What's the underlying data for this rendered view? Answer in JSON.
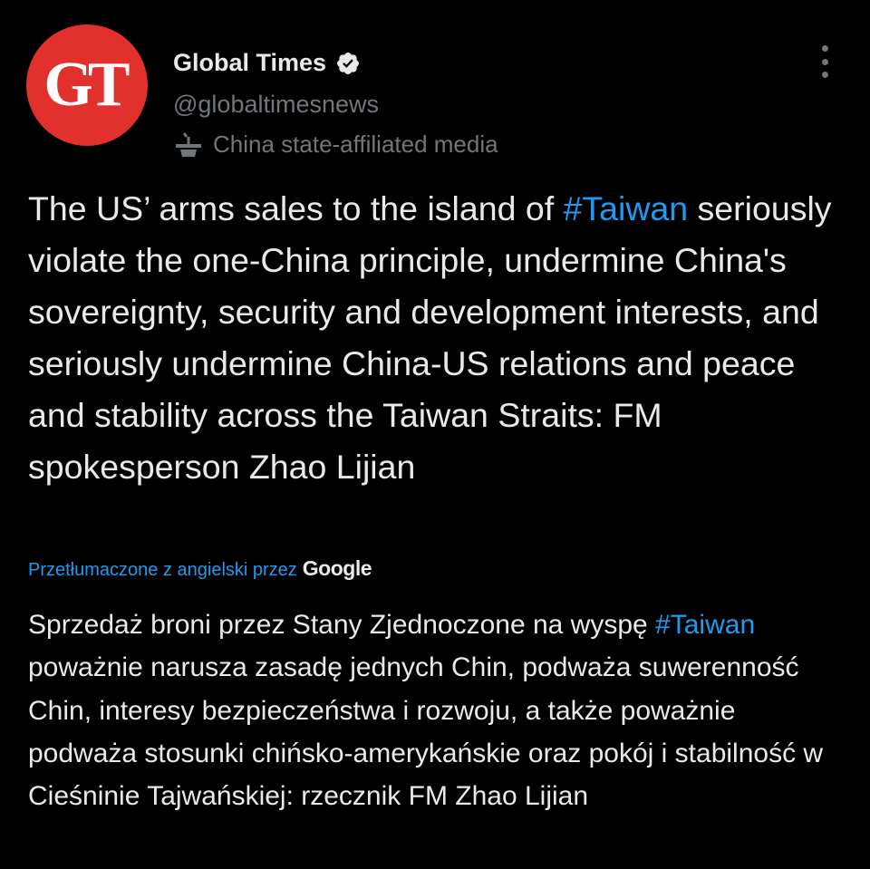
{
  "avatar": {
    "text": "GT",
    "color": "#e2302c"
  },
  "author": {
    "name": "Global Times",
    "handle": "@globaltimesnews",
    "label": "China state-affiliated media",
    "verified_icon": "verified-badge-icon",
    "label_icon": "podium-icon"
  },
  "menu": {
    "icon": "more-vertical-icon"
  },
  "tweet": {
    "text_before": "The US’ arms sales to the island of ",
    "hashtag": "#Taiwan",
    "text_after": " seriously violate the one-China principle, undermine China's sovereignty, security and development interests, and seriously undermine China-US relations and peace and stability across the Taiwan Straits: FM spokesperson Zhao Lijian"
  },
  "translation_notice": {
    "text": "Przetłumaczone z angielski przez",
    "provider": "Google"
  },
  "translation": {
    "text_before": "Sprzedaż broni przez Stany Zjednoczone na wyspę ",
    "hashtag": "#Taiwan",
    "text_after": " poważnie narusza zasadę jednych Chin, podważa suwerenność Chin, interesy bezpieczeństwa i rozwoju, a także poważnie podważa stosunki chińsko-amerykańskie oraz pokój i stabilność w Cieśninie Tajwańskiej: rzecznik FM Zhao Lijian"
  },
  "colors": {
    "background": "#000000",
    "text": "#e7e9ea",
    "secondary": "#71767b",
    "link": "#1d9bf0"
  }
}
